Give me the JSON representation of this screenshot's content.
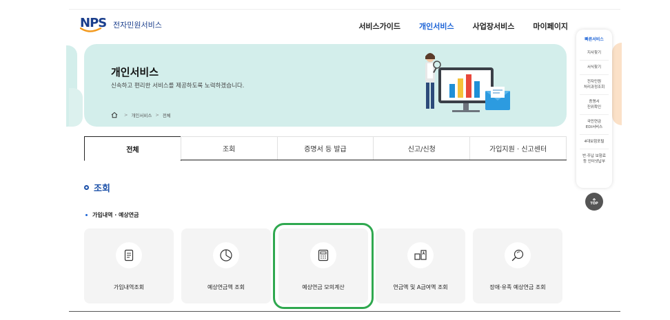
{
  "header": {
    "logo_mark": "NPS",
    "logo_text": "전자민원서비스",
    "nav": [
      {
        "label": "서비스가이드",
        "active": false
      },
      {
        "label": "개인서비스",
        "active": true
      },
      {
        "label": "사업장서비스",
        "active": false
      },
      {
        "label": "마이페이지",
        "active": false
      }
    ]
  },
  "banner": {
    "title": "개인서비스",
    "subtitle": "신속하고 편리한 서비스를 제공하도록 노력하겠습니다.",
    "breadcrumb": [
      "개인서비스",
      "전체"
    ]
  },
  "tabs": [
    {
      "label": "전체",
      "active": true
    },
    {
      "label": "조회",
      "active": false
    },
    {
      "label": "증명서 등 발급",
      "active": false
    },
    {
      "label": "신고/신청",
      "active": false
    },
    {
      "label": "가입지원 · 신고센터",
      "active": false
    }
  ],
  "section": {
    "title": "조회",
    "subtitle": "가입내역 · 예상연금"
  },
  "cards": [
    {
      "label": "가입내역조회",
      "icon": "document-list-icon"
    },
    {
      "label": "예상연금액 조회",
      "icon": "pie-chart-icon"
    },
    {
      "label": "예상연금 모의계산",
      "icon": "calculator-icon"
    },
    {
      "label": "연금액 및 A급여액 조회",
      "icon": "compare-amount-icon"
    },
    {
      "label": "장애·유족 예상연금 조회",
      "icon": "magnifier-icon"
    }
  ],
  "quick_menu": {
    "title": "빠른서비스",
    "items": [
      [
        "지사찾기"
      ],
      [
        "서식찾기"
      ],
      [
        "전자민원",
        "처리과정조회"
      ],
      [
        "증명서",
        "진위확인"
      ],
      [
        "국민연금",
        "EDI서비스"
      ],
      [
        "4대보험포털"
      ],
      [
        "반·주납 보험료",
        "등 인터넷납부"
      ]
    ],
    "top_label": "TOP"
  },
  "colors": {
    "accent": "#1c63d6",
    "banner_bg": "#d3eeeb",
    "highlight": "#2fa84f"
  }
}
